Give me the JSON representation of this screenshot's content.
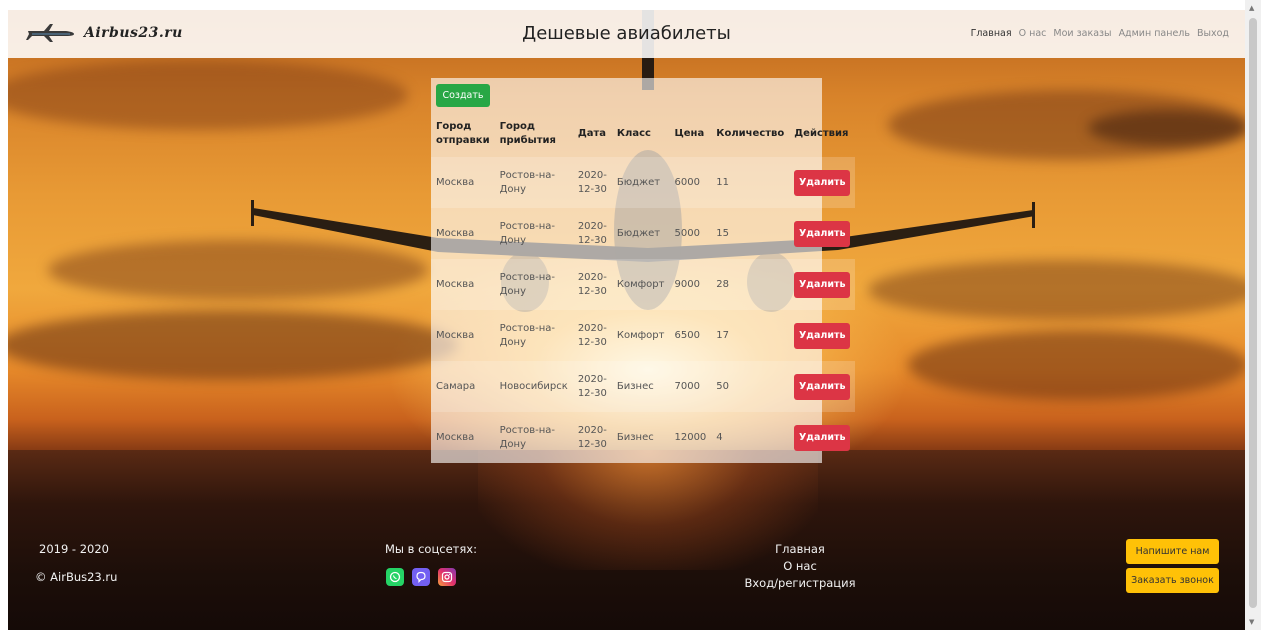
{
  "navbar": {
    "brand": "Airbus23.ru",
    "title": "Дешевые авиабилеты",
    "links": [
      {
        "label": "Главная"
      },
      {
        "label": "О нас"
      },
      {
        "label": "Мои заказы"
      },
      {
        "label": "Админ панель"
      },
      {
        "label": "Выход"
      }
    ]
  },
  "table": {
    "create_label": "Создать",
    "headers": [
      "Город отправки",
      "Город прибытия",
      "Дата",
      "Класс",
      "Цена",
      "Количество",
      "Действия"
    ],
    "delete_label": "Удалить",
    "rows": [
      [
        "Москва",
        "Ростов-на-Дону",
        "2020-12-30",
        "Бюджет",
        "6000",
        "11"
      ],
      [
        "Москва",
        "Ростов-на-Дону",
        "2020-12-30",
        "Бюджет",
        "5000",
        "15"
      ],
      [
        "Москва",
        "Ростов-на-Дону",
        "2020-12-30",
        "Комфорт",
        "9000",
        "28"
      ],
      [
        "Москва",
        "Ростов-на-Дону",
        "2020-12-30",
        "Комфорт",
        "6500",
        "17"
      ],
      [
        "Самара",
        "Новосибирск",
        "2020-12-30",
        "Бизнес",
        "7000",
        "50"
      ],
      [
        "Москва",
        "Ростов-на-Дону",
        "2020-12-30",
        "Бизнес",
        "12000",
        "4"
      ]
    ]
  },
  "footer": {
    "years": "2019 - 2020",
    "copyright": "© AirBus23.ru",
    "social_title": "Мы в соцсетях:",
    "social_icons": [
      "whatsapp-icon",
      "viber-icon",
      "instagram-icon"
    ],
    "links": [
      "Главная",
      "О нас",
      "Вход/регистрация"
    ],
    "write_us": "Напишите нам",
    "call_me": "Заказать звонок"
  },
  "colors": {
    "create_button": "#28a745",
    "delete_button": "#dc3545",
    "yellow_button": "#ffc107",
    "whatsapp": "#25d366",
    "viber": "#7360f2",
    "instagram": "#e1306c"
  }
}
